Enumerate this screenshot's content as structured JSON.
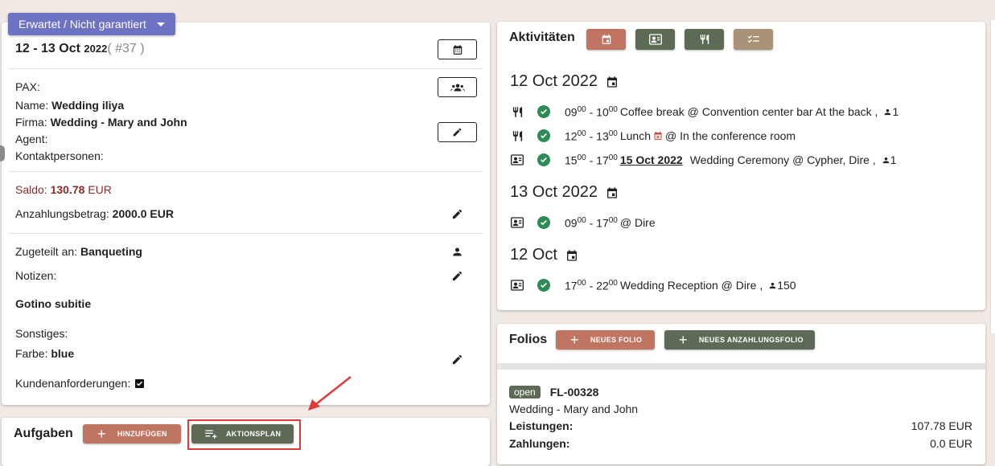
{
  "status": {
    "label": "Erwartet / Nicht garantiert"
  },
  "booking": {
    "date_range": "12 - 13 Oct",
    "year": "2022",
    "number": "( #37 )",
    "pax_label": "PAX:",
    "name_label": "Name:",
    "name_value": "Wedding iliya",
    "firma_label": "Firma:",
    "firma_value": "Wedding - Mary and John",
    "agent_label": "Agent:",
    "kontakt_label": "Kontaktpersonen:",
    "saldo_label": "Saldo:",
    "saldo_value": "130.78",
    "saldo_currency": "EUR",
    "anzahlung_label": "Anzahlungsbetrag:",
    "anzahlung_value": "2000.0 EUR",
    "zugeteilt_label": "Zugeteilt an:",
    "zugeteilt_value": "Banqueting",
    "notizen_label": "Notizen:",
    "notes_text": "Gotino subitie",
    "sonstiges_label": "Sonstiges:",
    "farbe_label": "Farbe:",
    "farbe_value": "blue",
    "kunden_label": "Kundenanforderungen:"
  },
  "tasks": {
    "title": "Aufgaben",
    "add_label": "HINZUFÜGEN",
    "plan_label": "AKTIONSPLAN"
  },
  "activities": {
    "title": "Aktivitäten",
    "buttons": [
      {
        "icon": "calendar-icon",
        "color": "#c07563"
      },
      {
        "icon": "contact-card-icon",
        "color": "#5d6b56"
      },
      {
        "icon": "restaurant-icon",
        "color": "#5d6b56"
      },
      {
        "icon": "checklist-icon",
        "color": "#a89379"
      }
    ],
    "groups": [
      {
        "date": "12 Oct 2022",
        "items": [
          {
            "type": "restaurant-icon",
            "start_h": "09",
            "start_m": "00",
            "end_h": "10",
            "end_m": "00",
            "desc": "Coffee break @ Convention center bar At the back ,",
            "pax": "1"
          },
          {
            "type": "restaurant-icon",
            "start_h": "12",
            "start_m": "00",
            "end_h": "13",
            "end_m": "00",
            "desc_pre": "Lunch",
            "desc": "@ In the conference room"
          },
          {
            "type": "contact-card-icon",
            "start_h": "15",
            "start_m": "00",
            "end_h": "17",
            "end_m": "00",
            "link": "15 Oct 2022",
            "desc": "Wedding Ceremony @ Cypher, Dire ,",
            "pax": "1"
          }
        ]
      },
      {
        "date": "13 Oct 2022",
        "items": [
          {
            "type": "contact-card-icon",
            "start_h": "09",
            "start_m": "00",
            "end_h": "17",
            "end_m": "00",
            "desc": "@ Dire"
          }
        ]
      },
      {
        "date": "12 Oct",
        "items": [
          {
            "type": "contact-card-icon",
            "start_h": "17",
            "start_m": "00",
            "end_h": "22",
            "end_m": "00",
            "desc": "Wedding Reception @ Dire ,",
            "pax": "150"
          }
        ]
      }
    ]
  },
  "folios": {
    "title": "Folios",
    "new_label": "NEUES FOLIO",
    "new_deposit_label": "NEUES ANZAHLUNGSFOLIO",
    "status_badge": "open",
    "folio_id": "FL-00328",
    "name": "Wedding - Mary and John",
    "leistungen_label": "Leistungen:",
    "leistungen_value": "107.78 EUR",
    "zahlungen_label": "Zahlungen:",
    "zahlungen_value": "0.0 EUR"
  },
  "colors": {
    "accent": "#6e72c3",
    "saldo": "#8b2a2a",
    "success": "#2e8b57",
    "highlight": "#e03b3b"
  }
}
